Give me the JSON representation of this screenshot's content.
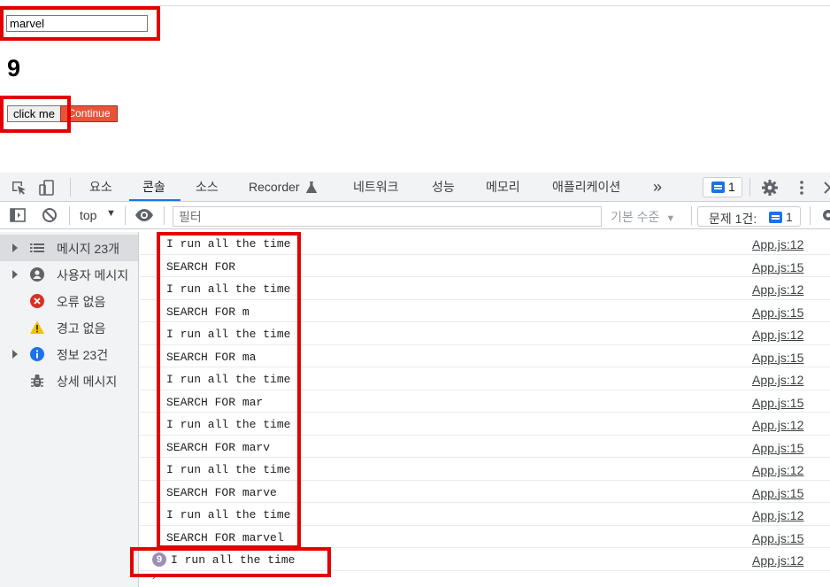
{
  "app": {
    "search_value": "marvel",
    "count": "9",
    "click_button": "click me",
    "continue_button": "Continue"
  },
  "devtools": {
    "tabs": [
      "요소",
      "콘솔",
      "소스",
      "Recorder",
      "네트워크",
      "성능",
      "메모리",
      "애플리케이션"
    ],
    "active_tab": "콘솔",
    "more_tabs": "»",
    "message_badge_count": "1",
    "toolbar": {
      "context": "top",
      "filter_placeholder": "필터",
      "level": "기본 수준",
      "issues": "문제 1건:",
      "issues_count": "1"
    },
    "sidebar": [
      {
        "label": "메시지 23개",
        "icon": "list-icon",
        "expandable": true,
        "selected": true
      },
      {
        "label": "사용자 메시지",
        "icon": "user-icon",
        "expandable": true,
        "selected": false
      },
      {
        "label": "오류 없음",
        "icon": "error-icon",
        "expandable": false,
        "selected": false
      },
      {
        "label": "경고 없음",
        "icon": "warning-icon",
        "expandable": false,
        "selected": false
      },
      {
        "label": "정보 23건",
        "icon": "info-icon",
        "expandable": true,
        "selected": false
      },
      {
        "label": "상세 메시지",
        "icon": "bug-icon",
        "expandable": false,
        "selected": false
      }
    ],
    "console_rows": [
      {
        "text": "I run all the time",
        "source": "App.js:12"
      },
      {
        "text": "SEARCH FOR",
        "source": "App.js:15"
      },
      {
        "text": "I run all the time",
        "source": "App.js:12"
      },
      {
        "text": "SEARCH FOR m",
        "source": "App.js:15"
      },
      {
        "text": "I run all the time",
        "source": "App.js:12"
      },
      {
        "text": "SEARCH FOR ma",
        "source": "App.js:15"
      },
      {
        "text": "I run all the time",
        "source": "App.js:12"
      },
      {
        "text": "SEARCH FOR mar",
        "source": "App.js:15"
      },
      {
        "text": "I run all the time",
        "source": "App.js:12"
      },
      {
        "text": "SEARCH FOR marv",
        "source": "App.js:15"
      },
      {
        "text": "I run all the time",
        "source": "App.js:12"
      },
      {
        "text": "SEARCH FOR marve",
        "source": "App.js:15"
      },
      {
        "text": "I run all the time",
        "source": "App.js:12"
      },
      {
        "text": "SEARCH FOR marvel",
        "source": "App.js:15"
      },
      {
        "text": "I run all the time",
        "source": "App.js:12",
        "repeat": "9"
      }
    ],
    "prompt": "›"
  },
  "colors": {
    "highlight": "#e40000",
    "continue_button": "#e8543a",
    "accent": "#1a73e8"
  }
}
